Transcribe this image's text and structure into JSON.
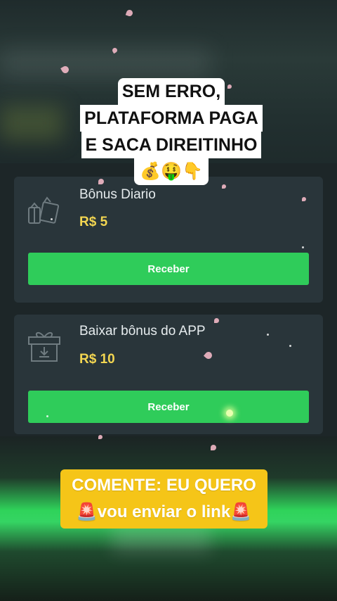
{
  "overlay": {
    "headline_lines": [
      "SEM ERRO,",
      "PLATAFORMA PAGA",
      "E SACA DIREITINHO",
      "💰🤑👇"
    ],
    "cta_lines": [
      "COMENTE: EU QUERO",
      "🚨vou enviar o link🚨"
    ]
  },
  "bonus_cards": [
    {
      "title": "Bônus Diario",
      "amount": "R$ 5",
      "button_label": "Receber",
      "icon": "gift-box-outline-icon"
    },
    {
      "title": "Baixar bônus do APP",
      "amount": "R$ 10",
      "button_label": "Receber",
      "icon": "gift-download-icon"
    }
  ],
  "colors": {
    "accent_button": "#2fcc5a",
    "amount_text": "#f3d651",
    "card_background": "#29353a",
    "cta_background": "#f5c518"
  }
}
